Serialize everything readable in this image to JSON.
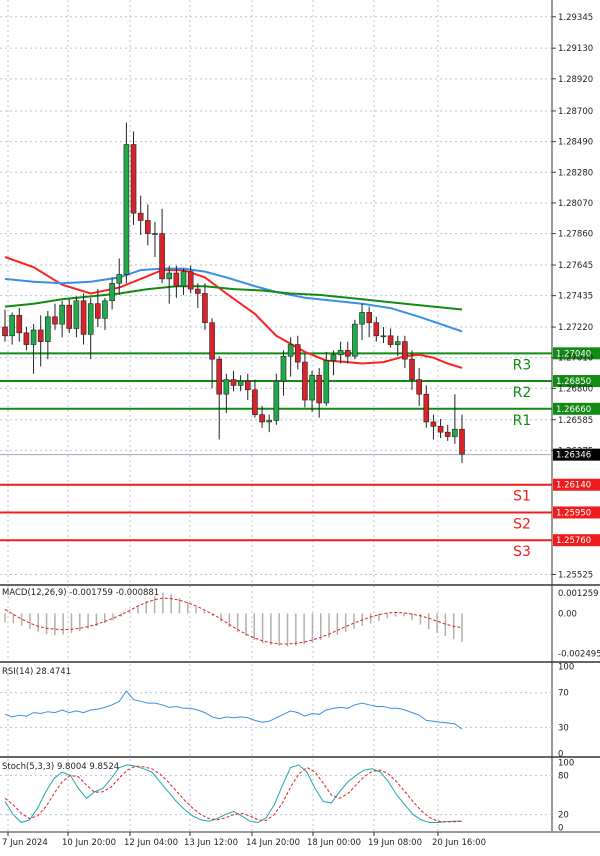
{
  "chart_data": {
    "type": "candlestick",
    "price_scale": {
      "tick_labels": [
        "1.29345",
        "1.29130",
        "1.28920",
        "1.28700",
        "1.28490",
        "1.28280",
        "1.28070",
        "1.27860",
        "1.27645",
        "1.27435",
        "1.27220",
        "1.27010",
        "1.26800",
        "1.26585",
        "1.26375",
        "1.25525"
      ],
      "ylim": [
        1.2546,
        1.2946
      ]
    },
    "current_price": {
      "value": 1.26346,
      "label": "1.26346"
    },
    "pivot_levels": [
      {
        "name": "R3",
        "value": 1.2704,
        "label": "1.27040",
        "kind": "resistance"
      },
      {
        "name": "R2",
        "value": 1.2685,
        "label": "1.26850",
        "kind": "resistance"
      },
      {
        "name": "R1",
        "value": 1.2666,
        "label": "1.26660",
        "kind": "resistance"
      },
      {
        "name": "S1",
        "value": 1.2614,
        "label": "1.26140",
        "kind": "support"
      },
      {
        "name": "S2",
        "value": 1.2595,
        "label": "1.25950",
        "kind": "support"
      },
      {
        "name": "S3",
        "value": 1.2576,
        "label": "1.25760",
        "kind": "support"
      }
    ],
    "x_tick_labels": [
      "7 Jun 2024",
      "10 Jun 20:00",
      "12 Jun 04:00",
      "13 Jun 12:00",
      "14 Jun 20:00",
      "18 Jun 00:00",
      "19 Jun 08:00",
      "20 Jun 16:00"
    ],
    "candles": [
      {
        "o": 1.2722,
        "h": 1.2734,
        "l": 1.2712,
        "c": 1.2716
      },
      {
        "o": 1.2716,
        "h": 1.2732,
        "l": 1.271,
        "c": 1.273
      },
      {
        "o": 1.273,
        "h": 1.2735,
        "l": 1.2712,
        "c": 1.2718
      },
      {
        "o": 1.2718,
        "h": 1.2722,
        "l": 1.2706,
        "c": 1.271
      },
      {
        "o": 1.271,
        "h": 1.2724,
        "l": 1.269,
        "c": 1.272
      },
      {
        "o": 1.272,
        "h": 1.273,
        "l": 1.2695,
        "c": 1.2712
      },
      {
        "o": 1.2712,
        "h": 1.2733,
        "l": 1.27,
        "c": 1.2729
      },
      {
        "o": 1.2729,
        "h": 1.2738,
        "l": 1.272,
        "c": 1.2724
      },
      {
        "o": 1.2724,
        "h": 1.274,
        "l": 1.2715,
        "c": 1.2737
      },
      {
        "o": 1.2737,
        "h": 1.2741,
        "l": 1.2718,
        "c": 1.2721
      },
      {
        "o": 1.2721,
        "h": 1.2743,
        "l": 1.2715,
        "c": 1.274
      },
      {
        "o": 1.274,
        "h": 1.2745,
        "l": 1.271,
        "c": 1.2717
      },
      {
        "o": 1.2717,
        "h": 1.2742,
        "l": 1.27,
        "c": 1.2738
      },
      {
        "o": 1.2738,
        "h": 1.2748,
        "l": 1.2722,
        "c": 1.2728
      },
      {
        "o": 1.2728,
        "h": 1.2742,
        "l": 1.272,
        "c": 1.274
      },
      {
        "o": 1.274,
        "h": 1.2756,
        "l": 1.2734,
        "c": 1.2752
      },
      {
        "o": 1.2752,
        "h": 1.2769,
        "l": 1.2744,
        "c": 1.2758
      },
      {
        "o": 1.2758,
        "h": 1.2862,
        "l": 1.2752,
        "c": 1.2847
      },
      {
        "o": 1.2847,
        "h": 1.2856,
        "l": 1.2792,
        "c": 1.28
      },
      {
        "o": 1.28,
        "h": 1.2812,
        "l": 1.2785,
        "c": 1.2795
      },
      {
        "o": 1.2795,
        "h": 1.2806,
        "l": 1.2778,
        "c": 1.2786
      },
      {
        "o": 1.2786,
        "h": 1.2794,
        "l": 1.277,
        "c": 1.2786
      },
      {
        "o": 1.2786,
        "h": 1.2803,
        "l": 1.2752,
        "c": 1.2755
      },
      {
        "o": 1.2755,
        "h": 1.2764,
        "l": 1.2738,
        "c": 1.2759
      },
      {
        "o": 1.2759,
        "h": 1.2764,
        "l": 1.2742,
        "c": 1.275
      },
      {
        "o": 1.275,
        "h": 1.2762,
        "l": 1.2744,
        "c": 1.276
      },
      {
        "o": 1.276,
        "h": 1.2764,
        "l": 1.2745,
        "c": 1.2748
      },
      {
        "o": 1.2748,
        "h": 1.2752,
        "l": 1.2735,
        "c": 1.2745
      },
      {
        "o": 1.2745,
        "h": 1.2752,
        "l": 1.272,
        "c": 1.2725
      },
      {
        "o": 1.2725,
        "h": 1.2728,
        "l": 1.268,
        "c": 1.27
      },
      {
        "o": 1.27,
        "h": 1.2702,
        "l": 1.2645,
        "c": 1.2676
      },
      {
        "o": 1.2676,
        "h": 1.269,
        "l": 1.2663,
        "c": 1.2686
      },
      {
        "o": 1.2686,
        "h": 1.2692,
        "l": 1.2678,
        "c": 1.2682
      },
      {
        "o": 1.2682,
        "h": 1.2689,
        "l": 1.2678,
        "c": 1.2685
      },
      {
        "o": 1.2685,
        "h": 1.269,
        "l": 1.2672,
        "c": 1.2679
      },
      {
        "o": 1.2679,
        "h": 1.2686,
        "l": 1.266,
        "c": 1.2662
      },
      {
        "o": 1.2662,
        "h": 1.2668,
        "l": 1.2653,
        "c": 1.2657
      },
      {
        "o": 1.2657,
        "h": 1.2662,
        "l": 1.265,
        "c": 1.2658
      },
      {
        "o": 1.2658,
        "h": 1.269,
        "l": 1.2655,
        "c": 1.2685
      },
      {
        "o": 1.2685,
        "h": 1.2706,
        "l": 1.2675,
        "c": 1.2702
      },
      {
        "o": 1.2702,
        "h": 1.2715,
        "l": 1.2688,
        "c": 1.271
      },
      {
        "o": 1.271,
        "h": 1.2716,
        "l": 1.2693,
        "c": 1.2698
      },
      {
        "o": 1.2698,
        "h": 1.2704,
        "l": 1.2667,
        "c": 1.2672
      },
      {
        "o": 1.2672,
        "h": 1.2692,
        "l": 1.2664,
        "c": 1.2689
      },
      {
        "o": 1.2689,
        "h": 1.2694,
        "l": 1.266,
        "c": 1.267
      },
      {
        "o": 1.267,
        "h": 1.2705,
        "l": 1.2668,
        "c": 1.2699
      },
      {
        "o": 1.2699,
        "h": 1.2706,
        "l": 1.2689,
        "c": 1.2703
      },
      {
        "o": 1.2703,
        "h": 1.2712,
        "l": 1.2697,
        "c": 1.2706
      },
      {
        "o": 1.2706,
        "h": 1.2712,
        "l": 1.2697,
        "c": 1.2702
      },
      {
        "o": 1.2702,
        "h": 1.2727,
        "l": 1.27,
        "c": 1.2724
      },
      {
        "o": 1.2724,
        "h": 1.2738,
        "l": 1.2713,
        "c": 1.2732
      },
      {
        "o": 1.2732,
        "h": 1.2736,
        "l": 1.2715,
        "c": 1.2725
      },
      {
        "o": 1.2725,
        "h": 1.2729,
        "l": 1.2712,
        "c": 1.2716
      },
      {
        "o": 1.2716,
        "h": 1.2722,
        "l": 1.2711,
        "c": 1.2716
      },
      {
        "o": 1.2716,
        "h": 1.2721,
        "l": 1.2708,
        "c": 1.271
      },
      {
        "o": 1.271,
        "h": 1.2716,
        "l": 1.2702,
        "c": 1.2712
      },
      {
        "o": 1.2712,
        "h": 1.2716,
        "l": 1.2694,
        "c": 1.27
      },
      {
        "o": 1.27,
        "h": 1.2706,
        "l": 1.2679,
        "c": 1.2686
      },
      {
        "o": 1.2686,
        "h": 1.2694,
        "l": 1.2668,
        "c": 1.2676
      },
      {
        "o": 1.2676,
        "h": 1.2682,
        "l": 1.2653,
        "c": 1.2657
      },
      {
        "o": 1.2657,
        "h": 1.2662,
        "l": 1.2645,
        "c": 1.2654
      },
      {
        "o": 1.2654,
        "h": 1.2659,
        "l": 1.2646,
        "c": 1.265
      },
      {
        "o": 1.265,
        "h": 1.2655,
        "l": 1.2644,
        "c": 1.2647
      },
      {
        "o": 1.2647,
        "h": 1.2676,
        "l": 1.2642,
        "c": 1.2652
      },
      {
        "o": 1.2652,
        "h": 1.2662,
        "l": 1.2629,
        "c": 1.2635
      }
    ],
    "moving_averages": [
      {
        "name": "MA red",
        "color": "#ff2020",
        "points": [
          [
            0,
            1.277
          ],
          [
            4,
            1.2763
          ],
          [
            8,
            1.2751
          ],
          [
            12,
            1.2745
          ],
          [
            16,
            1.2749
          ],
          [
            19,
            1.2755
          ],
          [
            22,
            1.2761
          ],
          [
            25,
            1.2761
          ],
          [
            28,
            1.2756
          ],
          [
            31,
            1.2745
          ],
          [
            35,
            1.2731
          ],
          [
            38,
            1.2716
          ],
          [
            42,
            1.2705
          ],
          [
            45,
            1.2699
          ],
          [
            48,
            1.2698
          ],
          [
            50,
            1.2697
          ],
          [
            53,
            1.2698
          ],
          [
            56,
            1.2702
          ],
          [
            58,
            1.2703
          ],
          [
            60,
            1.2701
          ],
          [
            62,
            1.2697
          ],
          [
            64,
            1.2694
          ]
        ]
      },
      {
        "name": "MA blue",
        "color": "#3a8ee6",
        "points": [
          [
            0,
            1.2755
          ],
          [
            4,
            1.2753
          ],
          [
            8,
            1.2752
          ],
          [
            12,
            1.2753
          ],
          [
            16,
            1.2756
          ],
          [
            19,
            1.2761
          ],
          [
            22,
            1.2762
          ],
          [
            25,
            1.2762
          ],
          [
            28,
            1.276
          ],
          [
            31,
            1.2756
          ],
          [
            35,
            1.275
          ],
          [
            38,
            1.2746
          ],
          [
            42,
            1.2742
          ],
          [
            46,
            1.274
          ],
          [
            50,
            1.2738
          ],
          [
            54,
            1.2735
          ],
          [
            58,
            1.2729
          ],
          [
            61,
            1.2724
          ],
          [
            64,
            1.2719
          ]
        ]
      },
      {
        "name": "MA green",
        "color": "#138a13",
        "points": [
          [
            0,
            1.2736
          ],
          [
            4,
            1.2738
          ],
          [
            8,
            1.2741
          ],
          [
            12,
            1.2743
          ],
          [
            16,
            1.2745
          ],
          [
            20,
            1.2748
          ],
          [
            24,
            1.275
          ],
          [
            28,
            1.275
          ],
          [
            32,
            1.2748
          ],
          [
            36,
            1.2747
          ],
          [
            40,
            1.2745
          ],
          [
            44,
            1.2744
          ],
          [
            48,
            1.2742
          ],
          [
            52,
            1.274
          ],
          [
            56,
            1.2738
          ],
          [
            60,
            1.2736
          ],
          [
            64,
            1.2734
          ]
        ]
      }
    ],
    "macd": {
      "label": "MACD(12,26,9) -0.001759 -0.000881",
      "tick_labels": [
        "0.001259",
        "0.00",
        "-0.002495"
      ],
      "tick_values": [
        0.001259,
        0,
        -0.002495
      ],
      "ylim": [
        -0.0027,
        0.00145
      ],
      "histogram": [
        -0.00055,
        -0.00062,
        -0.00078,
        -0.00095,
        -0.00112,
        -0.00128,
        -0.00135,
        -0.0013,
        -0.00122,
        -0.00108,
        -0.00094,
        -0.00078,
        -0.0006,
        -0.00042,
        -0.0002,
        0.0001,
        0.0004,
        0.00075,
        0.00105,
        0.00128,
        0.0012,
        0.00095,
        0.0007,
        0.0004,
        0.00015,
        -0.00015,
        -0.0005,
        -0.00085,
        -0.00115,
        -0.0014,
        -0.00165,
        -0.00185,
        -0.00195,
        -0.002,
        -0.00205,
        -0.002,
        -0.0019,
        -0.0018,
        -0.00165,
        -0.0015,
        -0.00132,
        -0.00115,
        -0.00095,
        -0.00078,
        -0.00062,
        -0.00045,
        -0.0003,
        -0.0002,
        -0.00018,
        -0.0004,
        -0.0007,
        -0.00098,
        -0.0012,
        -0.0014,
        -0.0016,
        -0.00176
      ],
      "signal": [
        0.00025,
        -5e-05,
        -0.00035,
        -0.0006,
        -0.0008,
        -0.00092,
        -0.00098,
        -0.001,
        -0.00098,
        -0.00092,
        -0.00082,
        -0.00068,
        -0.0005,
        -0.0003,
        -8e-05,
        0.00018,
        0.00045,
        0.00068,
        0.00085,
        0.00095,
        0.00092,
        0.00082,
        0.00066,
        0.00046,
        0.00022,
        -5e-05,
        -0.00035,
        -0.00068,
        -0.001,
        -0.00128,
        -0.00152,
        -0.0017,
        -0.00182,
        -0.00189,
        -0.0019,
        -0.00186,
        -0.00178,
        -0.00165,
        -0.00148,
        -0.00128,
        -0.00105,
        -0.00082,
        -0.0006,
        -0.0004,
        -0.00022,
        -8e-05,
        2e-05,
        6e-05,
        4e-05,
        -4e-05,
        -0.00015,
        -0.0003,
        -0.00048,
        -0.00066,
        -0.0008,
        -0.00088
      ]
    },
    "rsi": {
      "label": "RSI(14) 28.4741",
      "tick_labels": [
        "100",
        "70",
        "30",
        "0"
      ],
      "tick_values": [
        100,
        70,
        30,
        0
      ],
      "ylim": [
        -3,
        103
      ],
      "values": [
        45,
        42,
        44,
        43,
        47,
        46,
        48,
        47,
        50,
        47,
        49,
        47,
        50,
        51,
        53,
        56,
        60,
        72,
        62,
        60,
        58,
        58,
        56,
        53,
        54,
        52,
        52,
        50,
        47,
        42,
        40,
        42,
        41,
        42,
        41,
        38,
        36,
        37,
        41,
        45,
        49,
        47,
        43,
        46,
        45,
        50,
        52,
        53,
        52,
        56,
        58,
        56,
        54,
        54,
        52,
        52,
        50,
        47,
        44,
        38,
        37,
        36,
        35,
        34,
        28
      ]
    },
    "stoch": {
      "label": "Stoch(5,3,3) 9.8004 9.8524",
      "tick_labels": [
        "100",
        "80",
        "20",
        "0"
      ],
      "tick_values": [
        100,
        80,
        20,
        0
      ],
      "ylim": [
        -5,
        105
      ],
      "main": [
        40,
        20,
        8,
        12,
        30,
        55,
        75,
        85,
        80,
        60,
        45,
        55,
        60,
        75,
        92,
        96,
        94,
        90,
        85,
        70,
        55,
        40,
        28,
        18,
        12,
        10,
        14,
        20,
        25,
        18,
        10,
        8,
        15,
        35,
        65,
        92,
        96,
        85,
        60,
        40,
        38,
        55,
        70,
        80,
        88,
        90,
        85,
        70,
        50,
        35,
        20,
        12,
        8,
        8,
        9,
        10,
        10
      ],
      "signal": [
        45,
        35,
        22,
        14,
        18,
        32,
        52,
        70,
        80,
        78,
        65,
        54,
        55,
        62,
        76,
        88,
        94,
        93,
        90,
        82,
        70,
        56,
        42,
        30,
        20,
        14,
        12,
        15,
        20,
        22,
        18,
        12,
        11,
        20,
        38,
        62,
        82,
        92,
        85,
        68,
        50,
        45,
        52,
        65,
        78,
        86,
        88,
        82,
        70,
        55,
        40,
        26,
        16,
        10,
        9,
        9,
        10
      ]
    }
  }
}
